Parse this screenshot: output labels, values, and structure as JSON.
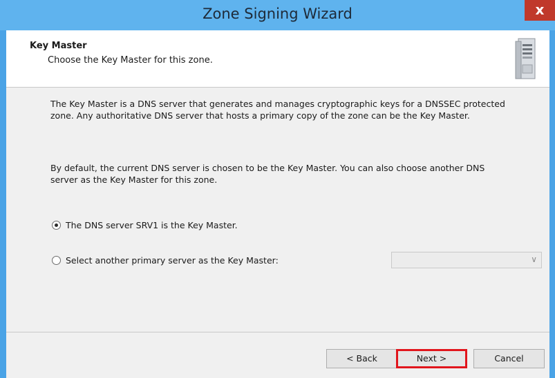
{
  "window": {
    "title": "Zone Signing Wizard",
    "close_glyph": "x"
  },
  "header": {
    "title": "Key Master",
    "subtitle": "Choose the Key Master for this zone.",
    "icon": "server-icon"
  },
  "body": {
    "paragraph1": "The Key Master is a DNS server that generates and manages cryptographic keys for a DNSSEC protected zone. Any authoritative DNS server that hosts a primary copy of the zone can be the Key Master.",
    "paragraph2": "By default, the current DNS server is chosen to be the Key Master. You can also choose another DNS server as the Key Master for this zone."
  },
  "options": {
    "option1_label": "The DNS server SRV1 is the Key Master.",
    "option1_selected": true,
    "option2_label": "Select another primary server as the Key Master:",
    "option2_selected": false,
    "combo_value": "",
    "combo_arrow": "∨"
  },
  "buttons": {
    "back": "< Back",
    "next": "Next >",
    "cancel": "Cancel"
  },
  "colors": {
    "title_bar": "#5fb3ee",
    "close_button": "#c0392b",
    "highlight": "#e1151c"
  }
}
